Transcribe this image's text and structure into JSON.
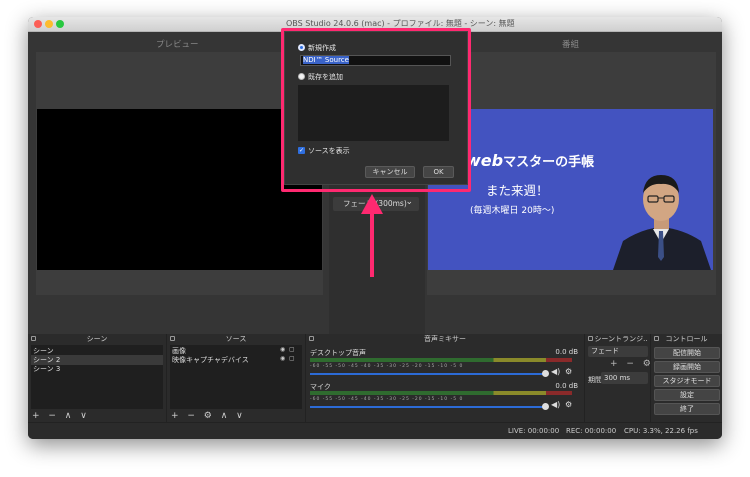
{
  "window": {
    "title": "OBS Studio 24.0.6 (mac) - プロファイル: 無題 - シーン: 無題"
  },
  "preview": {
    "label": "プレビュー"
  },
  "program": {
    "label": "番組",
    "banner_word": "web",
    "banner_rest": "マスターの手帳",
    "announce": "また来週！",
    "schedule": "(毎週木曜日 20時〜)"
  },
  "transition_selector": {
    "value": "フェード (300ms)",
    "chevron": "⌄"
  },
  "dialog": {
    "new_label": "新規作成",
    "name_value": "NDI™ Source",
    "existing_label": "既存を追加",
    "show_source_label": "ソースを表示",
    "cancel_label": "キャンセル",
    "ok_label": "OK"
  },
  "scenes": {
    "title": "シーン",
    "items": [
      "シーン",
      "シーン 2",
      "シーン 3"
    ],
    "tools": "+ −  ∧ ∨"
  },
  "sources": {
    "title": "ソース",
    "items": [
      "画像",
      "映像キャプチャデバイス"
    ],
    "tools": "+ − ⚙  ∧ ∨"
  },
  "mixer": {
    "title": "音声ミキサー",
    "channels": [
      {
        "name": "デスクトップ音声",
        "db": "0.0 dB"
      },
      {
        "name": "マイク",
        "db": "0.0 dB"
      }
    ],
    "scale": "-60 -55 -50 -45 -40 -35 -30 -25 -20 -15 -10 -5 0"
  },
  "transitions": {
    "title": "シーントランジ..",
    "selected": "フェード",
    "duration_label": "期間",
    "duration_value": "300 ms",
    "tools": "+ − ⚙"
  },
  "controls": {
    "title": "コントロール",
    "buttons": [
      "配信開始",
      "録画開始",
      "スタジオモード",
      "設定",
      "終了"
    ]
  },
  "status": {
    "live": "LIVE: 00:00:00",
    "rec": "REC: 00:00:00",
    "cpu": "CPU: 3.3%, 22.26 fps"
  },
  "colors": {
    "highlight": "#ff2970",
    "accent_blue": "#2c6bd6",
    "program_bg": "#4353c0"
  }
}
